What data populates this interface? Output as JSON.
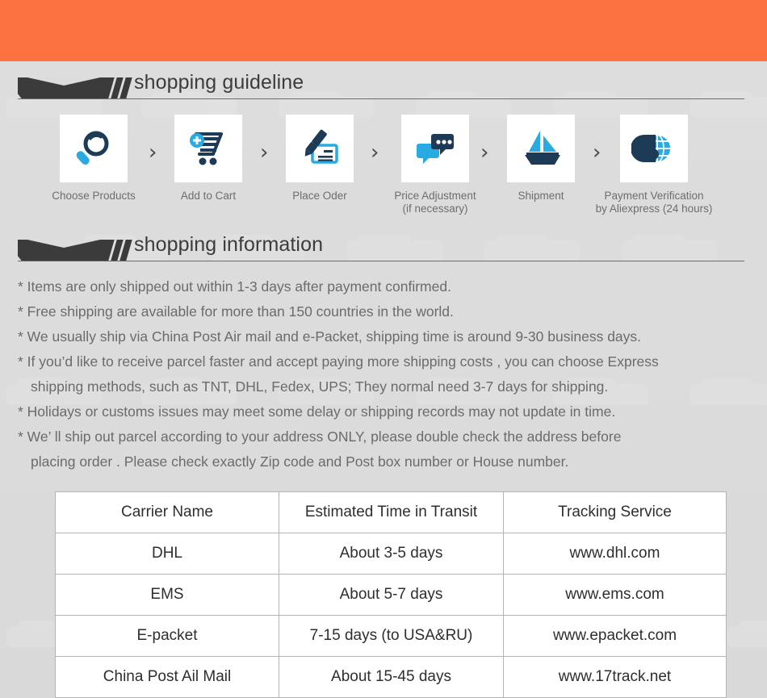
{
  "banner": {
    "color": "#fc7240"
  },
  "sections": {
    "guideline": {
      "title": "shopping guideline"
    },
    "information": {
      "title": "shopping information"
    }
  },
  "steps": [
    {
      "icon": "magnifier-icon",
      "label_line1": "Choose Products",
      "label_line2": ""
    },
    {
      "icon": "add-to-cart-icon",
      "label_line1": "Add to Cart",
      "label_line2": ""
    },
    {
      "icon": "pen-check-icon",
      "label_line1": "Place Oder",
      "label_line2": ""
    },
    {
      "icon": "chat-bubbles-icon",
      "label_line1": "Price Adjustment",
      "label_line2": "(if necessary)"
    },
    {
      "icon": "sailboat-icon",
      "label_line1": "Shipment",
      "label_line2": ""
    },
    {
      "icon": "dollar-globe-icon",
      "label_line1": "Payment Verification",
      "label_line2": "by  Aliexpress (24 hours)"
    }
  ],
  "step_separator": "›",
  "info_lines": [
    {
      "text": "* Items are only shipped out within 1-3 days after payment confirmed.",
      "indent": false
    },
    {
      "text": "* Free shipping are available for more than 150 countries in the world.",
      "indent": false
    },
    {
      "text": "* We usually ship via China Post Air mail and e-Packet, shipping time is around 9-30 business days.",
      "indent": false
    },
    {
      "text": "* If you’d like to receive parcel faster and accept paying more shipping costs , you can choose Express",
      "indent": false
    },
    {
      "text": "shipping methods, such as TNT, DHL, Fedex, UPS; They normal need 3-7 days for shipping.",
      "indent": true
    },
    {
      "text": "* Holidays or customs issues may meet some delay or shipping records may not update in time.",
      "indent": false
    },
    {
      "text": "* We’ ll ship out parcel according to your address ONLY, please double check the address before",
      "indent": false
    },
    {
      "text": "placing order . Please check exactly Zip code and Post box number or House number.",
      "indent": true
    }
  ],
  "carrier_table": {
    "headers": [
      "Carrier Name",
      "Estimated Time in Transit",
      "Tracking Service"
    ],
    "rows": [
      [
        "DHL",
        "About 3-5 days",
        "www.dhl.com"
      ],
      [
        "EMS",
        "About 5-7 days",
        "www.ems.com"
      ],
      [
        "E-packet",
        "7-15 days (to USA&RU)",
        "www.epacket.com"
      ],
      [
        "China Post Ail Mail",
        "About 15-45 days",
        "www.17track.net"
      ]
    ]
  },
  "colors": {
    "background": "#dcdcdc",
    "accent_orange": "#fc7240",
    "ribbon_dark": "#3b3b3b",
    "icon_dark_blue": "#1d3b56",
    "icon_light_blue": "#29abe2",
    "text_gray": "#6b6b6b",
    "table_border": "#b4b4b4"
  }
}
